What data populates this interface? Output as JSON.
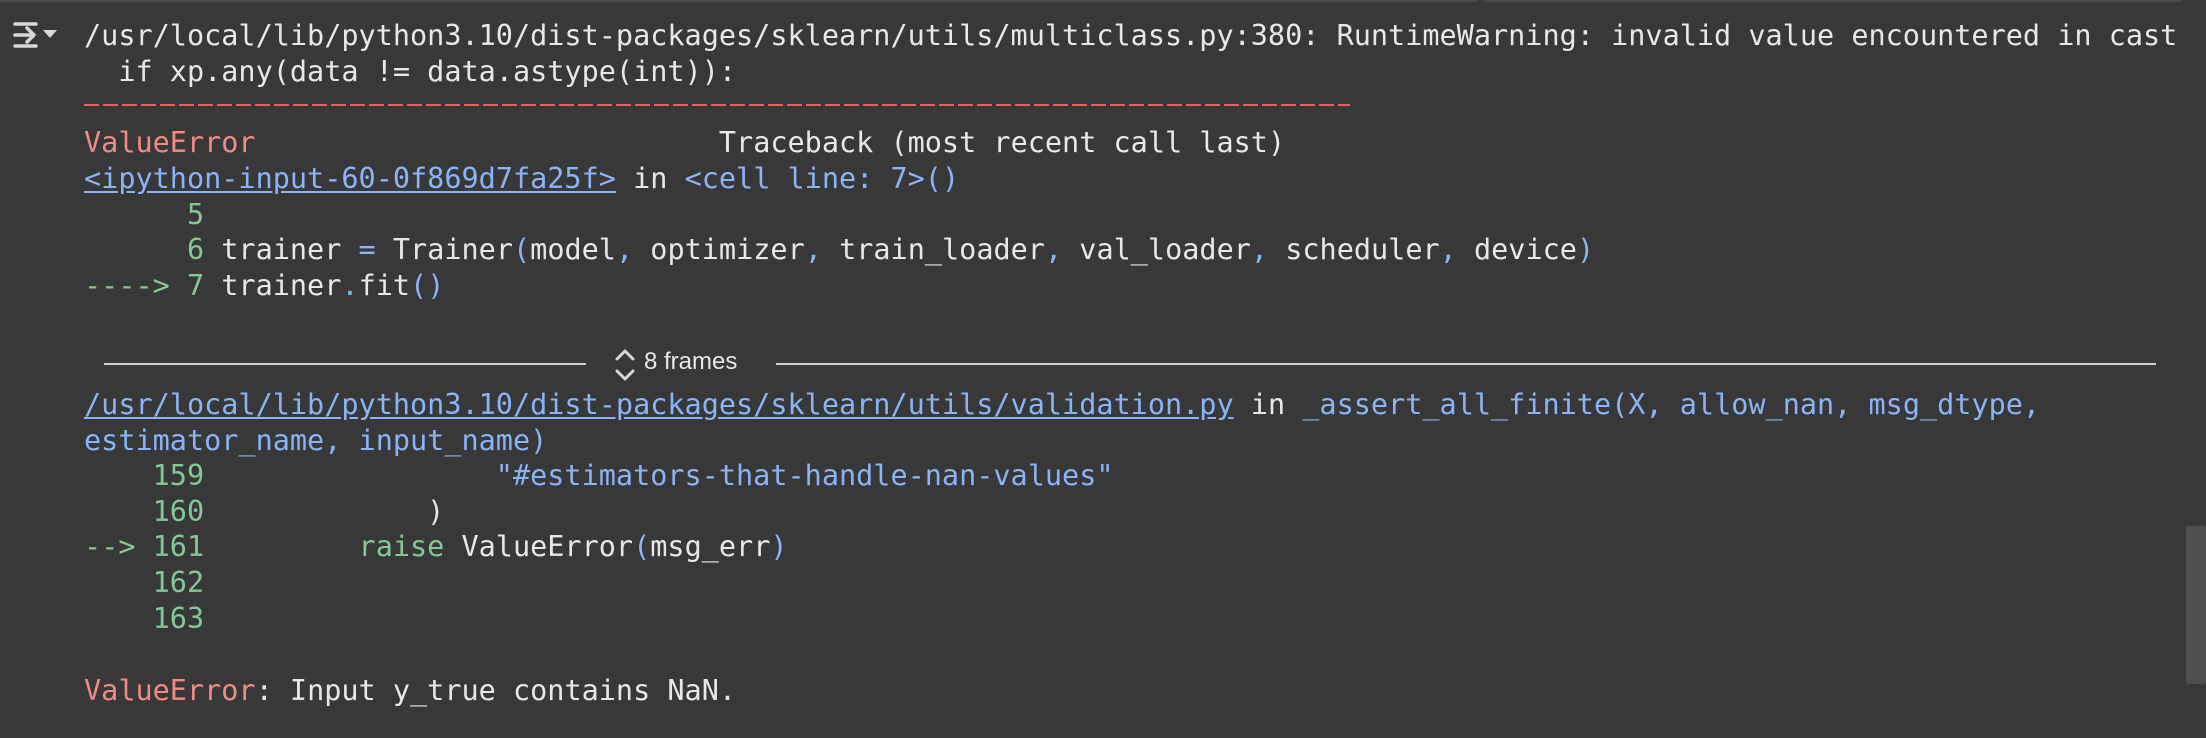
{
  "output": {
    "icon": "output-toggle-icon",
    "warning_line": "/usr/local/lib/python3.10/dist-packages/sklearn/utils/multiclass.py:380: RuntimeWarning: invalid value encountered in cast",
    "warning_code_line": "  if xp.any(data != data.astype(int)):",
    "traceback_header": {
      "error_name": "ValueError",
      "spacer": "                           ",
      "title": "Traceback (most recent call last)"
    },
    "cell_link": {
      "link_text": "<ipython-input-60-0f869d7fa25f>",
      "in_text": " in ",
      "location": "<cell line: 7>()"
    },
    "cell_lines": {
      "l5_num": "      5",
      "l6_num": "      6",
      "l6_trainer": " trainer ",
      "l6_eq": "=",
      "l6_call": " Trainer",
      "l6_paren_open": "(",
      "l6_model": "model",
      "l6_comma1": ",",
      "l6_optimizer": " optimizer",
      "l6_comma2": ",",
      "l6_train": " train_loader",
      "l6_comma3": ",",
      "l6_val": " val_loader",
      "l6_comma4": ",",
      "l6_sched": " scheduler",
      "l6_comma5": ",",
      "l6_device": " device",
      "l6_paren_close": ")",
      "l7_arrow": "----> 7",
      "l7_trainer": " trainer",
      "l7_dot": ".",
      "l7_fit": "fit",
      "l7_parens": "()"
    },
    "frames": {
      "label": "8 frames",
      "icon": "expand-collapse-icon"
    },
    "validation": {
      "link_text": "/usr/local/lib/python3.10/dist-packages/sklearn/utils/validation.py",
      "in_text": " in ",
      "func_name": "_assert_all_finite",
      "args_line1": "(X, allow_nan, msg_dtype,",
      "args_line2": "estimator_name, input_name)"
    },
    "validation_lines": {
      "l159_num": "    159",
      "l159_text": "                 \"#estimators-that-handle-nan-values\"",
      "l160_num": "    160",
      "l160_text": "             )",
      "l161_arrow": "--> 161",
      "l161_raise": "         raise",
      "l161_call": " ValueError",
      "l161_paren_open": "(",
      "l161_arg": "msg_err",
      "l161_paren_close": ")",
      "l162_num": "    162",
      "l163_num": "    163"
    },
    "final_error": {
      "name": "ValueError",
      "message": ": Input y_true contains NaN."
    }
  },
  "colors": {
    "background": "#383838",
    "error_red": "#f28b82",
    "line_number_green": "#81c995",
    "link_blue": "#8ab4f8",
    "text": "#d5d5d5"
  }
}
